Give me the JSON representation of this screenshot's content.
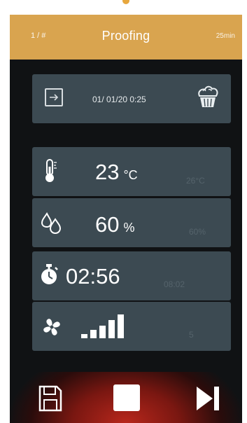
{
  "header": {
    "step": "1 / #",
    "title": "Proofing",
    "duration": "25min"
  },
  "info": {
    "datetime": "01/ 01/20  0:25",
    "icons": [
      "arrow-right-icon",
      "cupcake-icon"
    ]
  },
  "temperature": {
    "value": "23",
    "unit": "°C",
    "target": "26°C",
    "icon": "thermometer-icon"
  },
  "humidity": {
    "value": "60",
    "unit": "%",
    "target": "60%",
    "icon": "humidity-drops-icon"
  },
  "timer": {
    "value": "02:56",
    "target": "08:02",
    "icon": "stopwatch-icon"
  },
  "fan": {
    "level": 5,
    "target": "5",
    "icon": "fan-icon"
  },
  "controls": {
    "save_icon": "save-icon",
    "stop_icon": "stop-icon",
    "next_icon": "skip-next-icon"
  },
  "colors": {
    "header": "#d9a44f",
    "card": "#3c4a52",
    "background": "#101214",
    "accent_glow": "#b8271c"
  }
}
